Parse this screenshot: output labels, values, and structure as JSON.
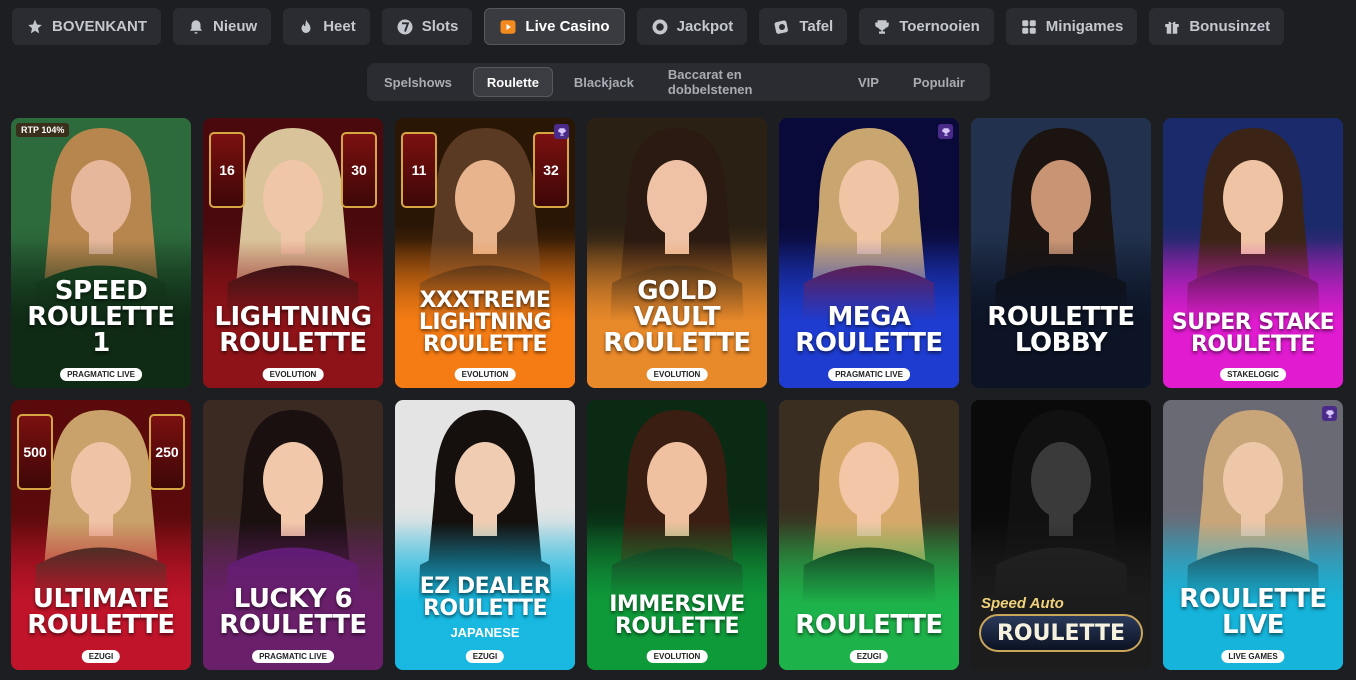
{
  "top_nav": [
    {
      "label": "BOVENKANT",
      "icon": "star-icon",
      "active": false
    },
    {
      "label": "Nieuw",
      "icon": "bell-icon",
      "active": false
    },
    {
      "label": "Heet",
      "icon": "flame-icon",
      "active": false
    },
    {
      "label": "Slots",
      "icon": "seven-icon",
      "active": false
    },
    {
      "label": "Live Casino",
      "icon": "live-play-icon",
      "active": true
    },
    {
      "label": "Jackpot",
      "icon": "coin-icon",
      "active": false
    },
    {
      "label": "Tafel",
      "icon": "chip-icon",
      "active": false
    },
    {
      "label": "Toernooien",
      "icon": "trophy-icon",
      "active": false
    },
    {
      "label": "Minigames",
      "icon": "grid-icon",
      "active": false
    },
    {
      "label": "Bonusinzet",
      "icon": "gift-icon",
      "active": false
    }
  ],
  "sub_nav": [
    {
      "label": "Spelshows",
      "active": false
    },
    {
      "label": "Roulette",
      "active": true
    },
    {
      "label": "Blackjack",
      "active": false
    },
    {
      "label": "Baccarat en dobbelstenen",
      "active": false
    },
    {
      "label": "VIP",
      "active": false
    },
    {
      "label": "Populair",
      "active": false
    }
  ],
  "games": [
    {
      "title": "SPEED\nROULETTE 1",
      "provider": "PRAGMATIC LIVE",
      "rtp": "RTP 104%",
      "bg1": "#2d6b3c",
      "bg2": "#0f2a15",
      "skin": "#e6b79a",
      "hair": "#b7864e",
      "dress": "#1b4a24"
    },
    {
      "title": "LIGHTNING\nROULETTE",
      "provider": "EVOLUTION",
      "mult_left": "16",
      "mult_right": "30",
      "bg1": "#4a0a0d",
      "bg2": "#8d1318",
      "skin": "#f0c6a8",
      "hair": "#d9c39a",
      "dress": "#141414"
    },
    {
      "title": "XXXTREME\nLIGHTNING\nROULETTE",
      "provider": "EVOLUTION",
      "mult_left": "11",
      "mult_right": "32",
      "trophy": true,
      "small": true,
      "bg1": "#2a1605",
      "bg2": "#f57c14",
      "skin": "#e8b48e",
      "hair": "#5a3a22",
      "dress": "#1a1a1a"
    },
    {
      "title": "GOLD VAULT\nROULETTE",
      "provider": "EVOLUTION",
      "bg1": "#2a2014",
      "bg2": "#e8892a",
      "skin": "#efc2a5",
      "hair": "#2a1a12",
      "dress": "#121212"
    },
    {
      "title": "MEGA\nROULETTE",
      "provider": "PRAGMATIC LIVE",
      "trophy": true,
      "bg1": "#0a0a3a",
      "bg2": "#1e3cd0",
      "skin": "#f0c5a6",
      "hair": "#c9a570",
      "dress": "#7b0f18"
    },
    {
      "title": "ROULETTE\nLOBBY",
      "provider": "",
      "bg1": "#22324e",
      "bg2": "#0c1426",
      "skin": "#c99474",
      "hair": "#1c1410",
      "dress": "#101010"
    },
    {
      "title": "SUPER STAKE\nROULETTE",
      "provider": "STAKELOGIC",
      "small": true,
      "bg1": "#1a2a6a",
      "bg2": "#e01bd0",
      "skin": "#efc4a4",
      "hair": "#3b2416",
      "dress": "#1a1a1a"
    },
    {
      "title": "ULTIMATE\nROULETTE",
      "provider": "EZUGI",
      "mult_left": "500",
      "mult_right": "250",
      "bg1": "#5a0a0a",
      "bg2": "#c0142a",
      "skin": "#efc4a6",
      "hair": "#c9a16a",
      "dress": "#1a3a22"
    },
    {
      "title": "LUCKY 6\nROULETTE",
      "provider": "PRAGMATIC LIVE",
      "bg1": "#3a2a22",
      "bg2": "#6a1f6a",
      "skin": "#f2c8aa",
      "hair": "#1a1010",
      "dress": "#5a1a7a"
    },
    {
      "title": "EZ DEALER\nROULETTE",
      "sub": "JAPANESE",
      "provider": "EZUGI",
      "small": true,
      "bg1": "#e4e4e4",
      "bg2": "#18b8e0",
      "skin": "#f0cdb2",
      "hair": "#15100e",
      "dress": "#111111"
    },
    {
      "title": "IMMERSIVE\nROULETTE",
      "provider": "EVOLUTION",
      "small": true,
      "bg1": "#0a2a14",
      "bg2": "#0f9a3a",
      "skin": "#efc1a0",
      "hair": "#3a1e12",
      "dress": "#1a1a1a"
    },
    {
      "title": "ROULETTE",
      "provider": "EZUGI",
      "bg1": "#3a2e20",
      "bg2": "#1eb24a",
      "skin": "#f2c6a6",
      "hair": "#d6a96a",
      "dress": "#141414"
    },
    {
      "title": "ROULETTE",
      "speedauto": "Speed Auto",
      "provider": "",
      "bg1": "#0a0a0a",
      "bg2": "#1c1c1c",
      "skin": "#3a3a3a",
      "hair": "#111111",
      "dress": "#222222"
    },
    {
      "title": "ROULETTE\nLIVE",
      "provider": "LIVE GAMES",
      "trophy": true,
      "bg1": "#6a6a74",
      "bg2": "#16b4da",
      "skin": "#eec6a8",
      "hair": "#c9a57a",
      "dress": "#2a2a2a"
    }
  ]
}
